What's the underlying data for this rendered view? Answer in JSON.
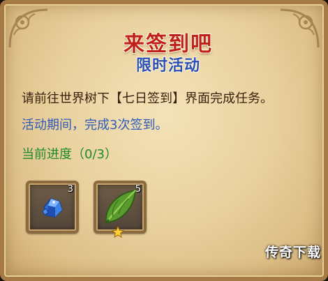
{
  "window": {
    "title": "来签到吧",
    "subtitle": "限时活动"
  },
  "content": {
    "instruction": "请前往世界树下【七日签到】界面完成任务。",
    "period": "活动期间，完成3次签到。",
    "progress": "当前进度（0/3）"
  },
  "rewards": [
    {
      "icon": "blue-crystal-icon",
      "count": "3"
    },
    {
      "icon": "green-leaf-icon",
      "count": "5",
      "starred": true
    }
  ],
  "watermark": "传奇下载",
  "colors": {
    "title": "#c0201a",
    "subtitle": "#2a50b8",
    "period": "#2f5ab8",
    "progress": "#1f8a2a",
    "frame": "#a67a45"
  }
}
